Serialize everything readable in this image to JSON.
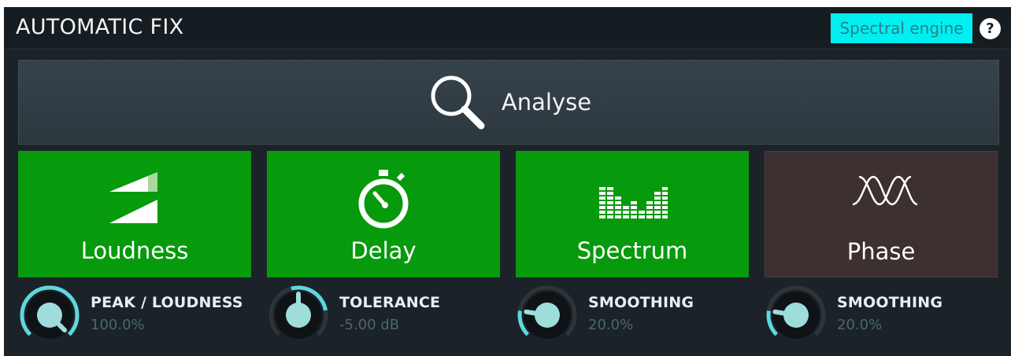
{
  "header": {
    "title": "AUTOMATIC FIX",
    "engine_button": "Spectral engine",
    "help": "?"
  },
  "analyse": {
    "label": "Analyse",
    "icon": "search-icon"
  },
  "tiles": [
    {
      "label": "Loudness",
      "icon": "loudness-icon",
      "active": true
    },
    {
      "label": "Delay",
      "icon": "stopwatch-icon",
      "active": true
    },
    {
      "label": "Spectrum",
      "icon": "spectrum-icon",
      "active": true
    },
    {
      "label": "Phase",
      "icon": "phase-icon",
      "active": false
    }
  ],
  "controls": [
    {
      "name": "PEAK / LOUDNESS",
      "value": "100.0%",
      "level": 1.0
    },
    {
      "name": "TOLERANCE",
      "value": "-5.00 dB",
      "level": 0.5
    },
    {
      "name": "SMOOTHING",
      "value": "20.0%",
      "level": 0.2
    },
    {
      "name": "SMOOTHING",
      "value": "20.0%",
      "level": 0.2
    }
  ],
  "colors": {
    "accent": "#00f0f2",
    "active_tile": "#079a0c",
    "inactive_tile": "#3c3031",
    "knob_arc": "#5fd8dc",
    "knob_cap": "#9fdcdc"
  }
}
